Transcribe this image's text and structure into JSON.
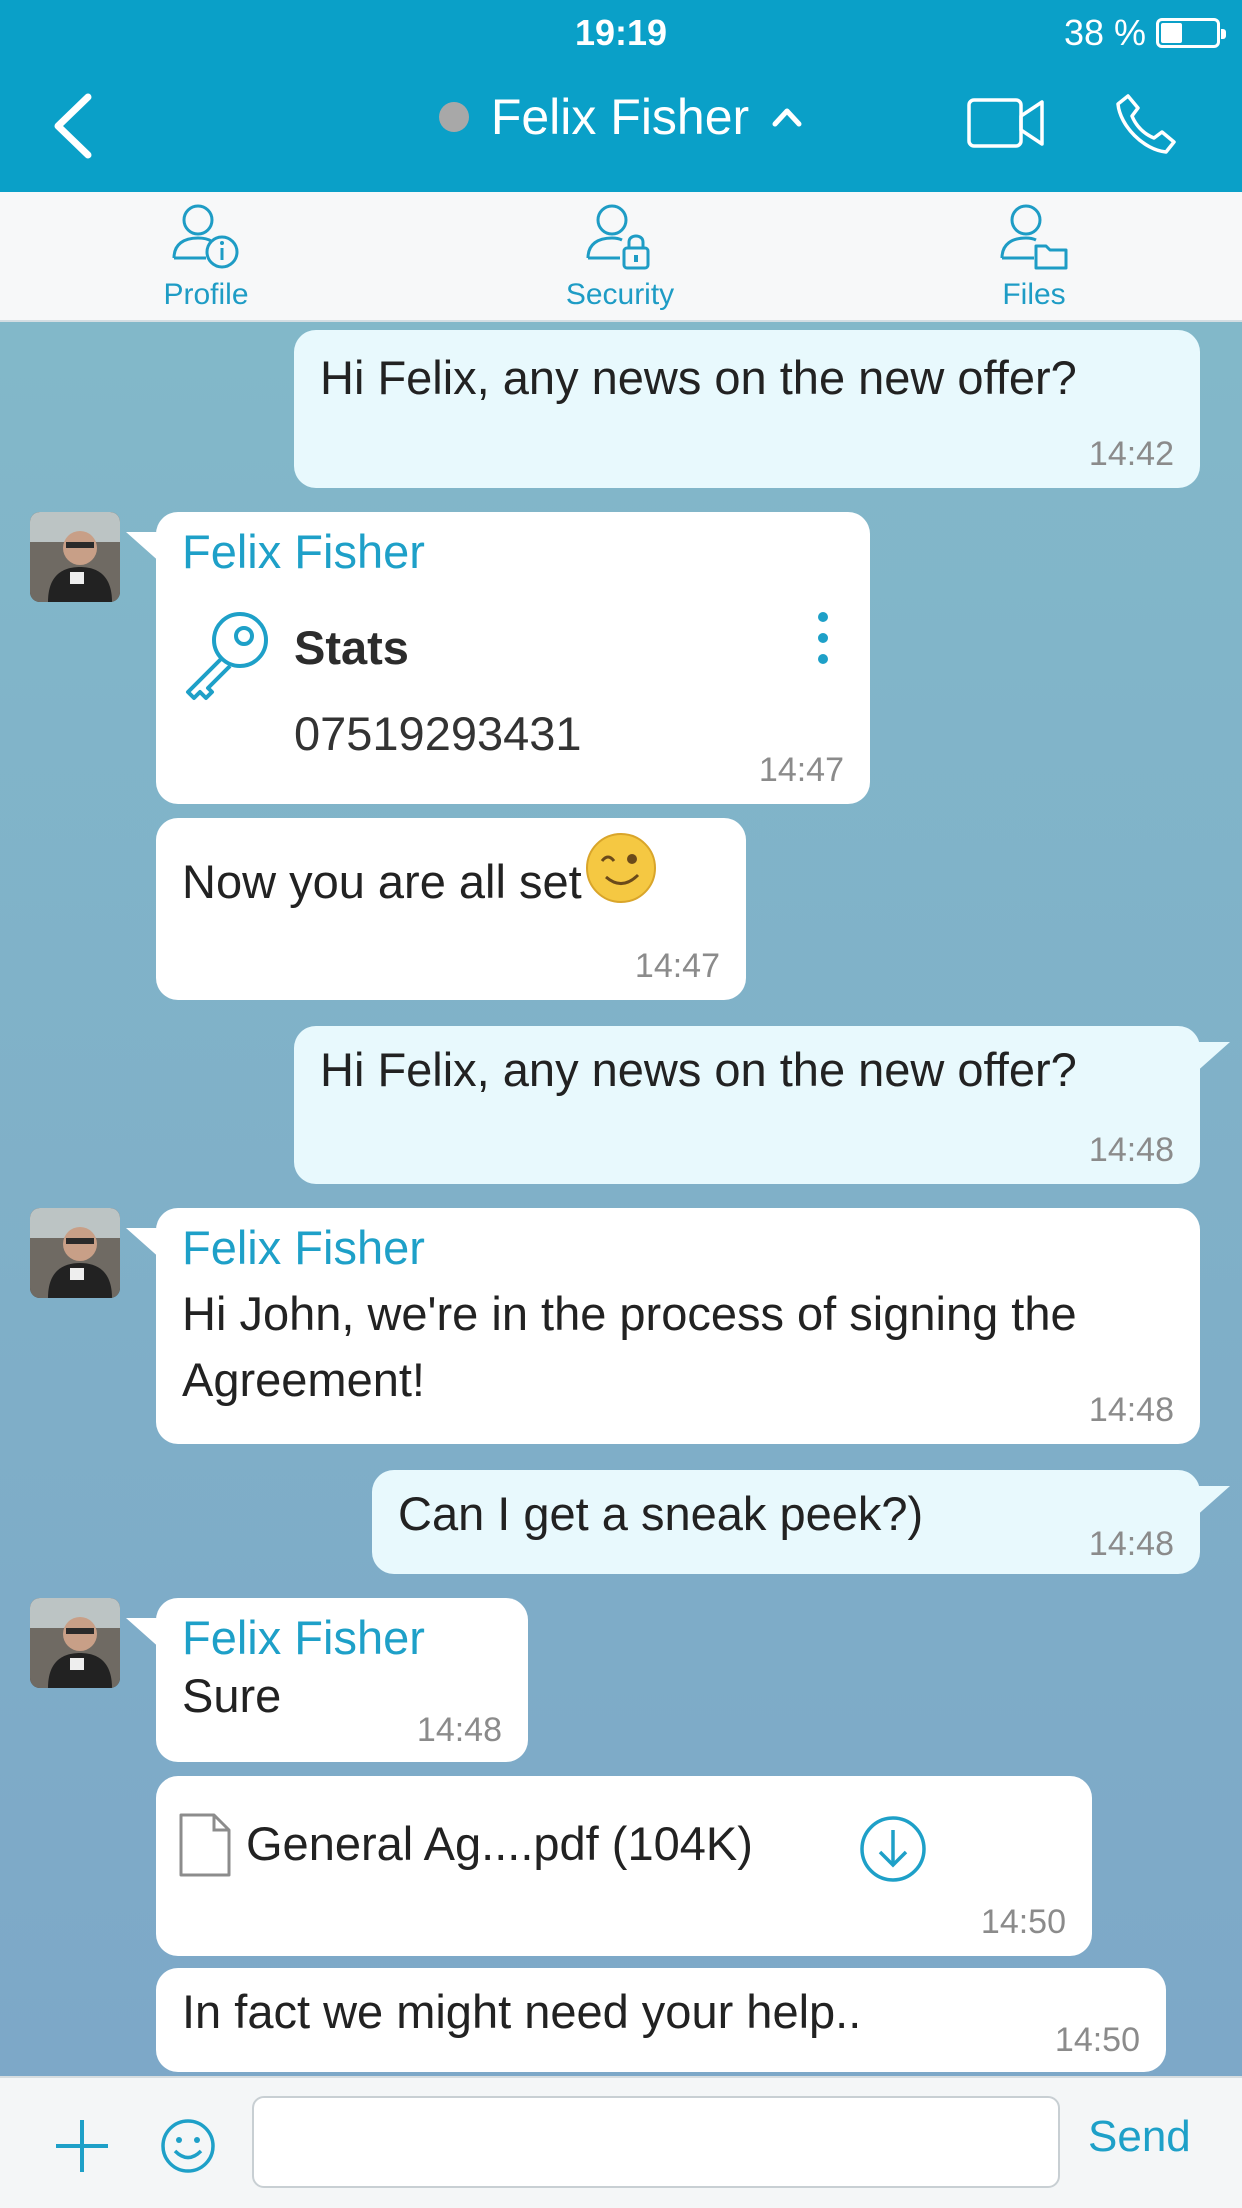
{
  "status_bar": {
    "time": "19:19",
    "battery_text": "38 %",
    "battery_level": 0.38
  },
  "header": {
    "contact_name": "Felix Fisher",
    "presence": "offline",
    "icons": {
      "back": "chevron-left-icon",
      "expand": "chevron-up-icon",
      "video": "video-camera-icon",
      "call": "phone-icon"
    }
  },
  "tabs": [
    {
      "label": "Profile",
      "icon": "user-info-icon"
    },
    {
      "label": "Security",
      "icon": "user-lock-icon"
    },
    {
      "label": "Files",
      "icon": "user-folder-icon"
    }
  ],
  "messages": [
    {
      "direction": "outgoing",
      "text": "Hi Felix, any news on the new offer?",
      "time": "14:42"
    },
    {
      "direction": "incoming",
      "sender": "Felix Fisher",
      "type": "contact-card",
      "card_title": "Stats",
      "card_value": "07519293431",
      "icon": "key-icon",
      "time": "14:47"
    },
    {
      "direction": "incoming",
      "text": "Now you are all set",
      "emoji": "wink-emoji",
      "time": "14:47"
    },
    {
      "direction": "outgoing",
      "text": "Hi Felix, any news on the new offer?",
      "time": "14:48"
    },
    {
      "direction": "incoming",
      "sender": "Felix Fisher",
      "text_line1": "Hi John, we're in the process of signing the",
      "text_line2": "Agreement!",
      "time": "14:48"
    },
    {
      "direction": "outgoing",
      "text": "Can I get a sneak peek?)",
      "time": "14:48"
    },
    {
      "direction": "incoming",
      "sender": "Felix Fisher",
      "text": "Sure",
      "time": "14:48"
    },
    {
      "direction": "incoming",
      "type": "file",
      "file_name": "General Ag....pdf (104K)",
      "icon": "document-icon",
      "action_icon": "download-icon",
      "time": "14:50"
    },
    {
      "direction": "incoming",
      "text": "In fact we might need your help..",
      "time": "14:50"
    }
  ],
  "composer": {
    "input_value": "",
    "placeholder": "",
    "send_label": "Send",
    "icons": {
      "add": "plus-icon",
      "emoji": "smiley-icon"
    }
  },
  "colors": {
    "accent": "#0aa0c8",
    "link": "#1ea0c8",
    "outgoing_bubble": "#e8f9fd",
    "incoming_bubble": "#ffffff"
  }
}
